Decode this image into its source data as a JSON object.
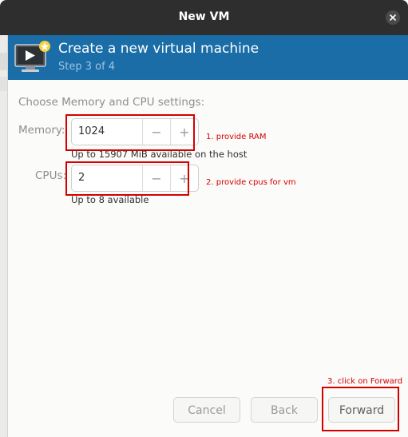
{
  "window": {
    "title": "New VM"
  },
  "banner": {
    "title": "Create a new virtual machine",
    "step": "Step 3 of 4"
  },
  "content": {
    "heading": "Choose Memory and CPU settings:",
    "memory": {
      "label": "Memory:",
      "value": "1024",
      "hint": "Up to 15907 MiB available on the host"
    },
    "cpus": {
      "label": "CPUs:",
      "value": "2",
      "hint": "Up to 8 available"
    },
    "minus_symbol": "−",
    "plus_symbol": "+"
  },
  "annotations": {
    "ram": "1. provide RAM",
    "cpus": "2. provide cpus for vm",
    "forward": "3. click on Forward"
  },
  "buttons": {
    "cancel": "Cancel",
    "back": "Back",
    "forward": "Forward"
  },
  "colors": {
    "titlebar": "#2e2e2e",
    "banner": "#1a6da7",
    "annotation": "#d40000"
  },
  "icons": {
    "close": "close-icon",
    "banner": "vm-monitor-icon"
  }
}
